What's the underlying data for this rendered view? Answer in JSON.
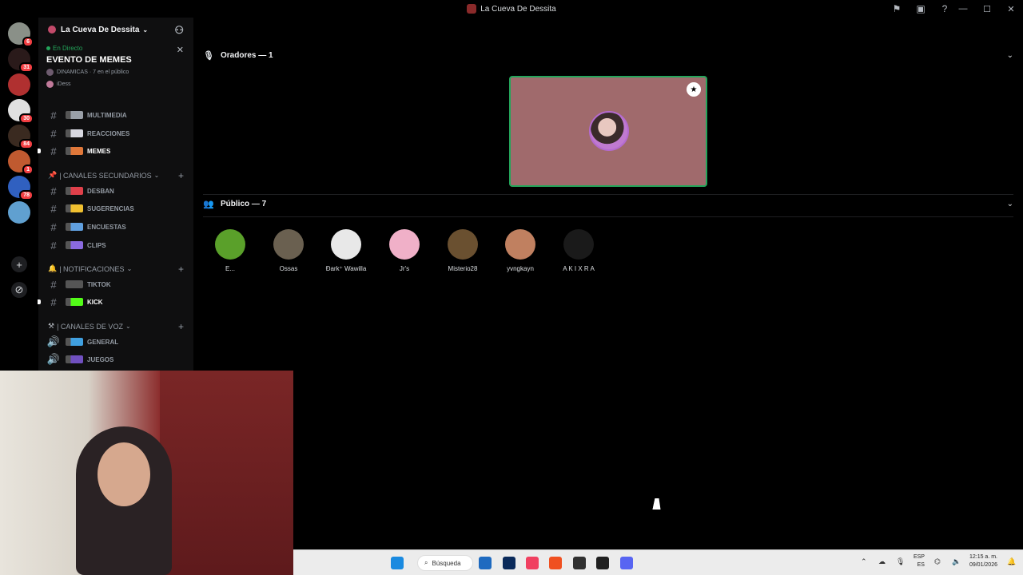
{
  "window": {
    "title": "La Cueva De Dessita"
  },
  "servers": [
    {
      "badge": "6"
    },
    {
      "badge": "31"
    },
    {
      "badge": ""
    },
    {
      "badge": "30"
    },
    {
      "badge": "84"
    },
    {
      "badge": "1"
    },
    {
      "badge": "78"
    },
    {
      "badge": ""
    }
  ],
  "sidebar": {
    "guild_name": "La Cueva De Dessita",
    "event": {
      "status": "En Directo",
      "title": "EVENTO DE MEMES",
      "meta": "DINAMICAS · 7 en el público",
      "host": "iDess"
    },
    "channels_top": [
      {
        "label": "MULTIMEDIA",
        "emoji_color": "#9aa0a8"
      },
      {
        "label": "REACCIONES",
        "emoji_color": "#d8d8e0"
      },
      {
        "label": "MEMES",
        "emoji_color": "#e0783a"
      }
    ],
    "cat_secondary": "| CANALES SECUNDARIOS",
    "channels_secondary": [
      {
        "label": "DESBAN",
        "emoji_color": "#e0404a"
      },
      {
        "label": "SUGERENCIAS",
        "emoji_color": "#f0c030"
      },
      {
        "label": "ENCUESTAS",
        "emoji_color": "#60a0e0"
      },
      {
        "label": "CLIPS",
        "emoji_color": "#8a6ae0"
      }
    ],
    "cat_notif": "| NOTIFICACIONES",
    "channels_notif": [
      {
        "label": "TIKTOK",
        "emoji_color": "#555"
      },
      {
        "label": "KICK",
        "emoji_color": "#53fc18"
      }
    ],
    "cat_voice": "| CANALES DE VOZ",
    "channels_voice": [
      {
        "label": "GENERAL",
        "emoji_color": "#40a0e0"
      },
      {
        "label": "JUEGOS",
        "emoji_color": "#7050c0"
      }
    ]
  },
  "stage": {
    "speakers_label": "Oradores — 1",
    "audience_label": "Público — 7",
    "audience": [
      {
        "name": "E...",
        "color": "#5aa02a"
      },
      {
        "name": "Ossas",
        "color": "#6a6050"
      },
      {
        "name": "Ðark⁺ Wawilla",
        "color": "#e8e8e8"
      },
      {
        "name": "Jr's",
        "color": "#f0b0c8"
      },
      {
        "name": "Misterio28",
        "color": "#6a5030"
      },
      {
        "name": "yvngkayn",
        "color": "#c08060"
      },
      {
        "name": "A K I X R A",
        "color": "#1a1a1a"
      }
    ]
  },
  "taskbar": {
    "search": "Búsqueda",
    "lang": "ESP",
    "lang2": "ES",
    "time": "12:15 a. m.",
    "date": "09/01/2026"
  }
}
